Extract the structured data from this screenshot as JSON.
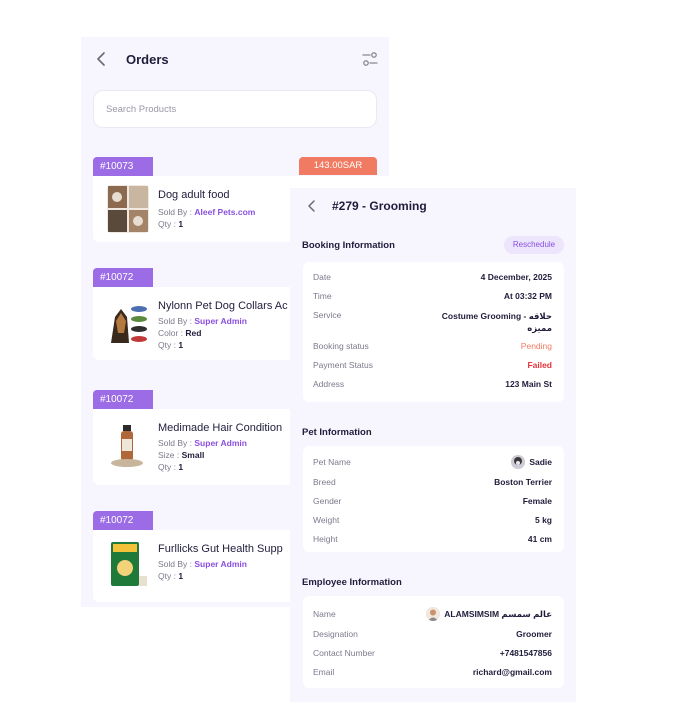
{
  "orders": {
    "title": "Orders",
    "search_placeholder": "Search Products",
    "items": [
      {
        "id": "#10073",
        "name": "Dog adult food",
        "sold_by_label": "Sold By : ",
        "sold_by": "Aleef Pets.com",
        "qty_label": "Qty : ",
        "qty": "1"
      },
      {
        "id": "#10072",
        "name": "Nylonn Pet Dog Collars Ac",
        "sold_by_label": "Sold By : ",
        "sold_by": "Super Admin",
        "color_label": "Color : ",
        "color": "Red",
        "qty_label": "Qty : ",
        "qty": "1"
      },
      {
        "id": "#10072",
        "name": "Medimade Hair Condition",
        "sold_by_label": "Sold By : ",
        "sold_by": "Super Admin",
        "size_label": "Size : ",
        "size": "Small",
        "qty_label": "Qty : ",
        "qty": "1"
      },
      {
        "id": "#10072",
        "name": "Furllicks Gut Health Supp",
        "sold_by_label": "Sold By : ",
        "sold_by": "Super Admin",
        "qty_label": "Qty : ",
        "qty": "1"
      }
    ],
    "price_badge": "143.00SAR"
  },
  "booking": {
    "title": "#279 - Grooming",
    "booking_section": "Booking Information",
    "reschedule": "Reschedule",
    "booking_info": {
      "date_label": "Date",
      "date": "4 December, 2025",
      "time_label": "Time",
      "time": "At 03:32 PM",
      "service_label": "Service",
      "service_line1": "Costume Grooming - حلاقه",
      "service_line2": "مميزه",
      "booking_status_label": "Booking status",
      "booking_status": "Pending",
      "payment_status_label": "Payment Status",
      "payment_status": "Failed",
      "address_label": "Address",
      "address": "123 Main St"
    },
    "pet_section": "Pet Information",
    "pet_info": {
      "name_label": "Pet Name",
      "name": "Sadie",
      "breed_label": "Breed",
      "breed": "Boston Terrier",
      "gender_label": "Gender",
      "gender": "Female",
      "weight_label": "Weight",
      "weight": "5 kg",
      "height_label": "Height",
      "height": "41 cm"
    },
    "employee_section": "Employee Information",
    "employee_info": {
      "name_label": "Name",
      "name": "ALAMSIMSIM عالم سمسم",
      "designation_label": "Designation",
      "designation": "Groomer",
      "contact_label": "Contact Number",
      "contact": "+7481547856",
      "email_label": "Email",
      "email": "richard@gmail.com"
    }
  },
  "colors": {
    "accent": "#9b6ce6",
    "link": "#8a4fe0",
    "price": "#f17b62",
    "pending": "#f17b62",
    "failed": "#e3323a",
    "background": "#f7f5fd"
  }
}
